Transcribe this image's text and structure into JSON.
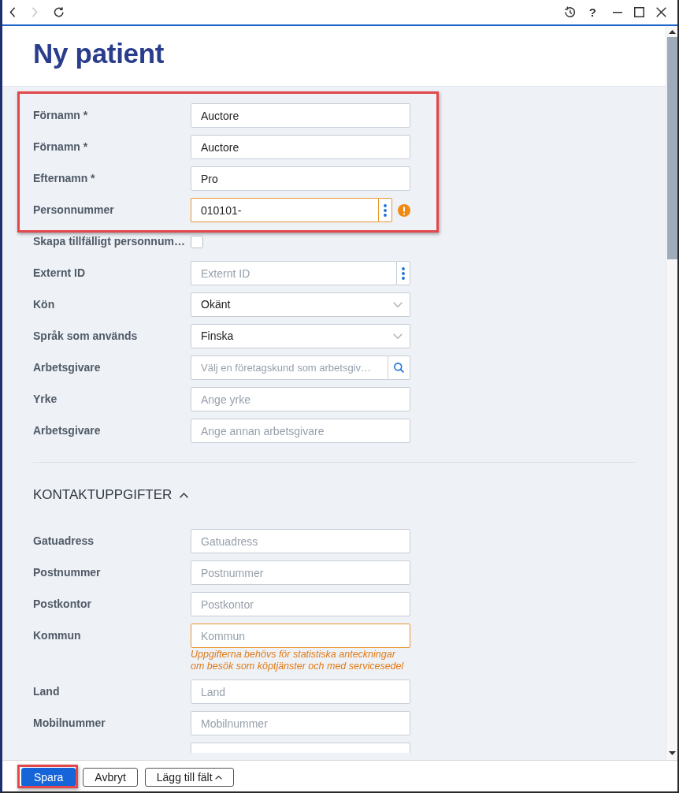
{
  "toolbar": {
    "nav_buttons": [
      {
        "kind": "back",
        "disabled": false
      },
      {
        "kind": "forward",
        "disabled": true
      },
      {
        "kind": "refresh",
        "disabled": false
      }
    ],
    "window_controls": [
      {
        "kind": "history"
      },
      {
        "kind": "help",
        "text": "?"
      },
      {
        "kind": "minimize"
      },
      {
        "kind": "maximize"
      },
      {
        "kind": "close"
      }
    ]
  },
  "header": {
    "title": "Ny patient"
  },
  "field_groups": [
    {
      "highlighted": true,
      "fields": [
        {
          "kind": "text",
          "label": "Förnamn *",
          "value": "Auctore",
          "warning": false
        },
        {
          "kind": "text",
          "label": "Förnamn *",
          "value": "Auctore",
          "warning": false
        },
        {
          "kind": "text",
          "label": "Efternamn *",
          "value": "Pro",
          "warning": false
        },
        {
          "kind": "menu-text",
          "label": "Personnummer",
          "value": "010101-",
          "warning": true,
          "alert_icon": true
        }
      ]
    },
    {
      "highlighted": false,
      "fields": [
        {
          "kind": "checkbox",
          "label": "Skapa tillfälligt personnum…",
          "checked": false
        },
        {
          "kind": "menu-text",
          "label": "Externt ID",
          "placeholder": "Externt ID",
          "warning": false,
          "alert_icon": false
        },
        {
          "kind": "select",
          "label": "Kön",
          "value": "Okänt"
        },
        {
          "kind": "select",
          "label": "Språk som används",
          "value": "Finska"
        },
        {
          "kind": "search",
          "label": "Arbetsgivare",
          "placeholder": "Välj en företagskund som arbetsgiv…",
          "warning": false
        },
        {
          "kind": "text",
          "label": "Yrke",
          "placeholder": "Ange yrke",
          "warning": false
        },
        {
          "kind": "text",
          "label": "Arbetsgivare",
          "placeholder": "Ange annan arbetsgivare",
          "warning": false
        }
      ]
    }
  ],
  "contact_section": {
    "title": "KONTAKTUPPGIFTER",
    "expanded": true,
    "fields": [
      {
        "kind": "text",
        "label": "Gatuadress",
        "placeholder": "Gatuadress",
        "warning": false
      },
      {
        "kind": "text",
        "label": "Postnummer",
        "placeholder": "Postnummer",
        "warning": false
      },
      {
        "kind": "text",
        "label": "Postkontor",
        "placeholder": "Postkontor",
        "warning": false
      },
      {
        "kind": "text",
        "label": "Kommun",
        "placeholder": "Kommun",
        "warning": true,
        "hint": "Uppgifterna behövs för statistiska anteckningar\nom besök som köptjänster och med servicesedel"
      },
      {
        "kind": "text",
        "label": "Land",
        "placeholder": "Land",
        "warning": false
      },
      {
        "kind": "text",
        "label": "Mobilnummer",
        "placeholder": "Mobilnummer",
        "warning": false
      },
      {
        "kind": "cut-off"
      }
    ]
  },
  "footer": {
    "buttons": [
      {
        "kind": "save",
        "label": "Spara",
        "highlighted": true
      },
      {
        "kind": "cancel",
        "label": "Avbryt",
        "highlighted": false
      },
      {
        "kind": "menu",
        "label": "Lägg till fält",
        "highlighted": false
      }
    ]
  }
}
